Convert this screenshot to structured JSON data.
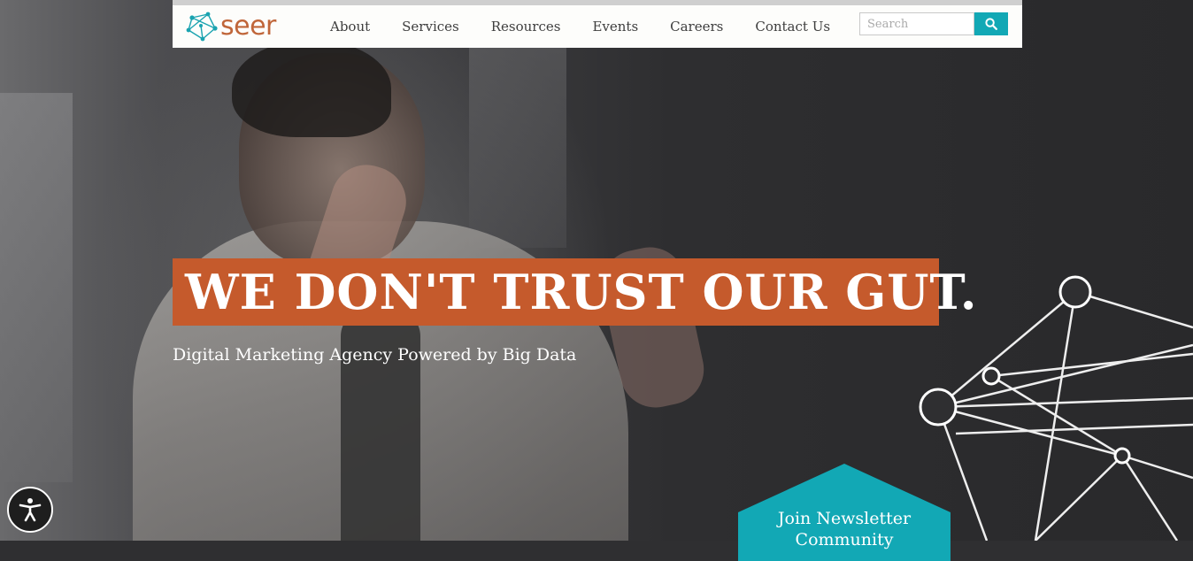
{
  "header": {
    "logo_text": "seer",
    "nav": [
      "About",
      "Services",
      "Resources",
      "Events",
      "Careers",
      "Contact Us"
    ],
    "search": {
      "placeholder": "Search",
      "value": ""
    }
  },
  "hero": {
    "headline": "WE DON'T TRUST OUR GUT.",
    "subhead": "Digital Marketing Agency Powered by Big Data"
  },
  "newsletter": {
    "label": "Join Newsletter Community"
  },
  "colors": {
    "brand_orange": "#c55a2c",
    "logo_orange": "#c0663a",
    "teal": "#12a8b5",
    "header_bg": "#fdfdfb"
  },
  "icons": [
    "seer-network-logo-icon",
    "search-icon",
    "accessibility-icon",
    "network-graph-illustration"
  ]
}
